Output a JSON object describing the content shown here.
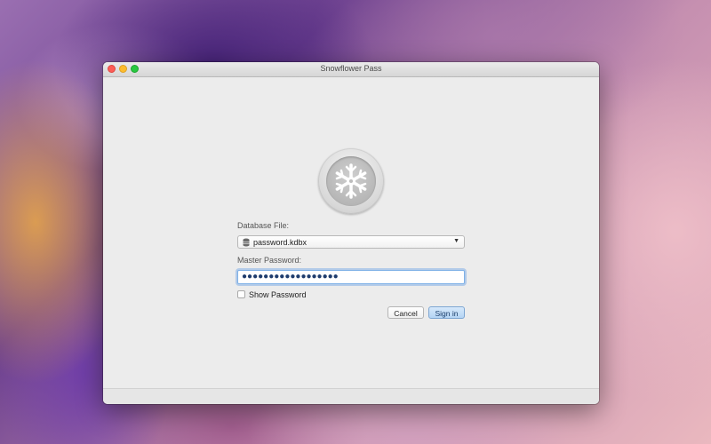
{
  "window": {
    "title": "Snowflower Pass"
  },
  "form": {
    "database_label": "Database File:",
    "database_value": "password.kdbx",
    "password_label": "Master Password:",
    "password_mask": "●●●●●●●●●●●●●●●●●●",
    "show_password_label": "Show Password",
    "show_password_checked": false,
    "cancel_label": "Cancel",
    "signin_label": "Sign in"
  },
  "icons": {
    "logo": "snowflake-icon",
    "database": "database-icon",
    "dropdown": "chevron-down-icon"
  },
  "colors": {
    "accent": "#7fb1e6",
    "signin_bg": "#b4d4f4"
  }
}
